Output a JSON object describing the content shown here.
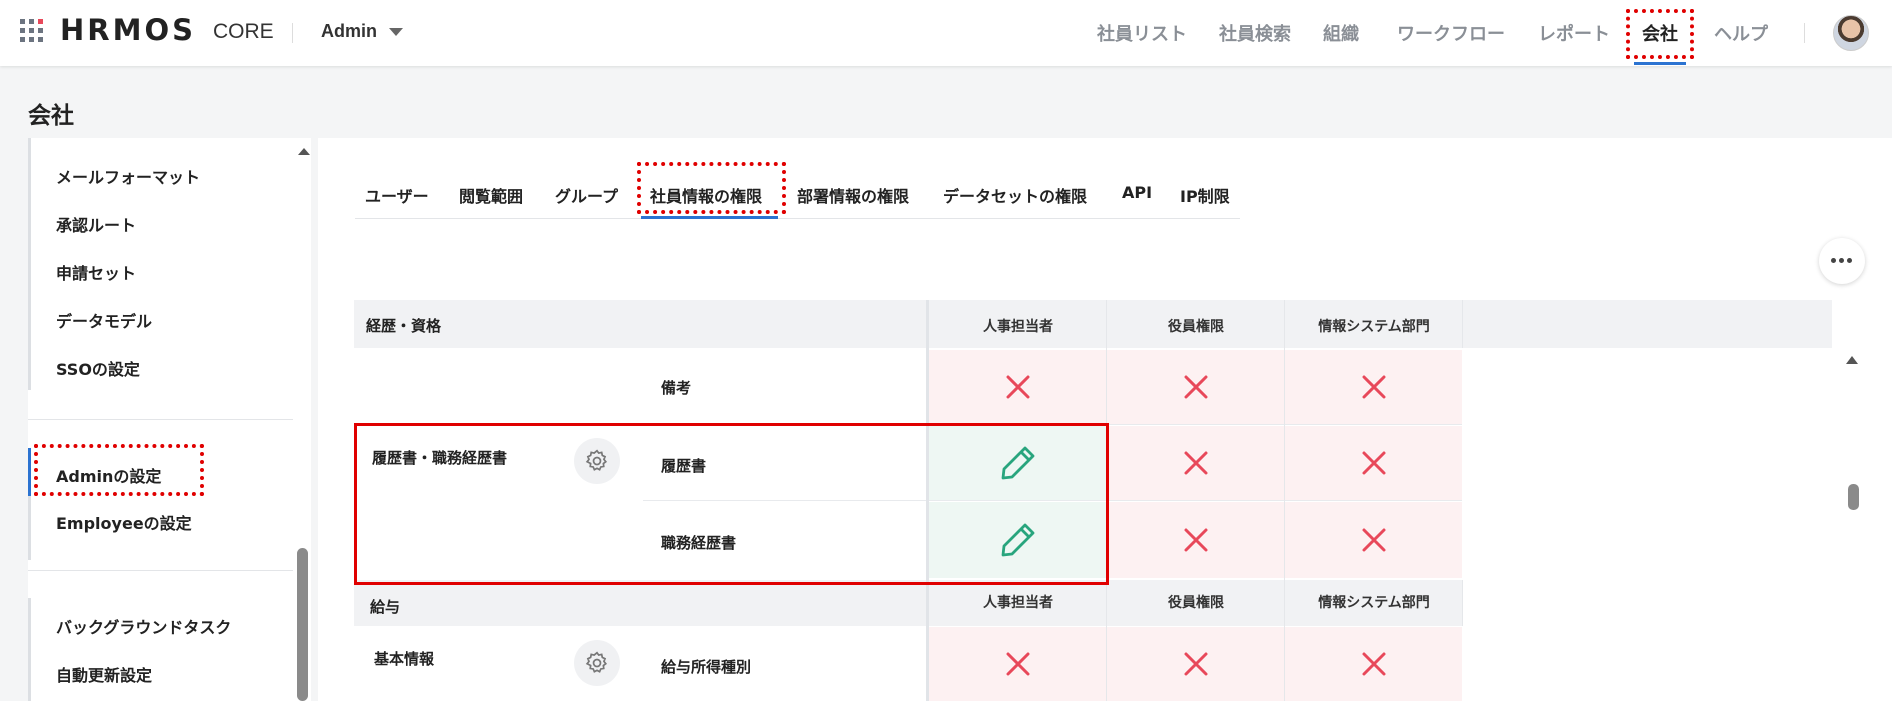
{
  "header": {
    "logo": "HRMOS",
    "product": "CORE",
    "workspace": "Admin",
    "nav": [
      "社員リスト",
      "社員検索",
      "組織",
      "ワークフロー",
      "レポート",
      "会社",
      "ヘルプ"
    ],
    "active_nav": "会社"
  },
  "page_title": "会社",
  "sidebar": {
    "group1": [
      "メールフォーマット",
      "承認ルート",
      "申請セット",
      "データモデル",
      "SSOの設定"
    ],
    "group2": [
      "Adminの設定",
      "Employeeの設定"
    ],
    "group3": [
      "バックグラウンドタスク",
      "自動更新設定"
    ],
    "active_item": "Adminの設定"
  },
  "tabs": [
    "ユーザー",
    "閲覧範囲",
    "グループ",
    "社員情報の権限",
    "部署情報の権限",
    "データセットの権限",
    "API",
    "IP制限"
  ],
  "active_tab": "社員情報の権限",
  "roles": [
    "人事担当者",
    "役員権限",
    "情報システム部門"
  ],
  "sections": [
    {
      "title": "経歴・資格",
      "rows": [
        {
          "group": "",
          "item": "備考",
          "perms": [
            "deny",
            "deny",
            "deny"
          ]
        },
        {
          "group": "履歴書・職務経歴書",
          "item": "履歴書",
          "perms": [
            "edit",
            "deny",
            "deny"
          ]
        },
        {
          "group": "",
          "item": "職務経歴書",
          "perms": [
            "edit",
            "deny",
            "deny"
          ]
        }
      ]
    },
    {
      "title": "給与",
      "rows": [
        {
          "group": "基本情報",
          "item": "給与所得種別",
          "perms": [
            "deny",
            "deny",
            "deny"
          ]
        }
      ]
    }
  ],
  "icons": {
    "apps": "grid-icon",
    "deny": "x-icon",
    "edit": "pencil-icon",
    "settings": "gear-icon",
    "more": "ellipsis-icon"
  },
  "colors": {
    "accent": "#2b73d1",
    "deny": "#e8485a",
    "edit": "#28a57d",
    "annotation": "#e00000"
  }
}
